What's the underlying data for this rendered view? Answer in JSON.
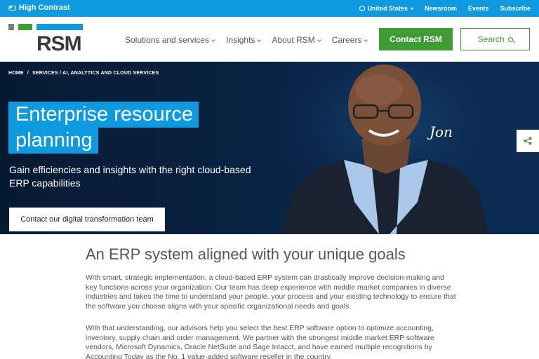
{
  "topbar": {
    "high_contrast": "High Contrast",
    "region": "United States",
    "newsroom": "Newsroom",
    "events": "Events",
    "subscribe": "Subscribe"
  },
  "header": {
    "logo_text": "RSM",
    "nav": [
      {
        "label": "Solutions and services"
      },
      {
        "label": "Insights"
      },
      {
        "label": "About RSM"
      },
      {
        "label": "Careers"
      }
    ],
    "contact_label": "Contact RSM",
    "search_label": "Search"
  },
  "hero": {
    "breadcrumb": [
      "HOME",
      "SERVICES / AI, ANALYTICS AND CLOUD SERVICES"
    ],
    "breadcrumb_sep": "/",
    "title_line1": "Enterprise resource",
    "title_line2": "planning",
    "subtitle": "Gain efficiencies and insights with the right cloud-based ERP capabilities",
    "cta_label": "Contact our digital transformation team",
    "signature": "Jon"
  },
  "content": {
    "heading": "An ERP system aligned with your unique goals",
    "paragraph1": "With smart, strategic implementation, a cloud-based ERP system can drastically improve decision-making and key functions across your organization. Our team has deep experience with middle market companies in diverse industries and takes the time to understand your people, your process and your existing technology to ensure that the software you choose aligns with your specific organizational needs and goals.",
    "paragraph2": "With that understanding, our advisors help you select the best ERP software option to optimize accounting, inventory, supply chain and order management. We partner with the strongest middle market ERP software vendors, Microsoft Dynamics, Oracle NetSuite and Sage Intacct, and have earned multiple recognitions by Accounting Today as the No. 1 value-added software reseller in the country."
  },
  "colors": {
    "brand_blue": "#0f9ae0",
    "brand_green": "#3f9c35",
    "hero_navy": "#0a2446"
  }
}
